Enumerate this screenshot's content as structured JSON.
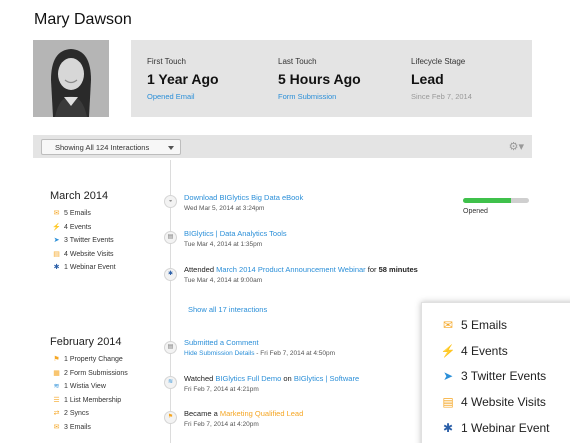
{
  "contact": {
    "name": "Mary Dawson"
  },
  "summary": {
    "first_touch": {
      "label": "First Touch",
      "value": "1 Year Ago",
      "detail": "Opened Email"
    },
    "last_touch": {
      "label": "Last Touch",
      "value": "5 Hours Ago",
      "detail": "Form Submission"
    },
    "lifecycle": {
      "label": "Lifecycle Stage",
      "value": "Lead",
      "detail": "Since Feb 7, 2014"
    }
  },
  "filter": {
    "label": "Showing All 124 Interactions"
  },
  "months": [
    {
      "title": "March 2014",
      "stats": [
        "5 Emails",
        "4 Events",
        "3 Twitter Events",
        "4 Website Visits",
        "1 Webinar Event"
      ]
    },
    {
      "title": "February 2014",
      "stats": [
        "1 Property Change",
        "2 Form Submissions",
        "1 Wistia View",
        "1 List Membership",
        "2 Syncs",
        "3 Emails"
      ]
    }
  ],
  "events": [
    {
      "title_link": "Download BIGlytics Big Data eBook",
      "date": "Wed Mar 5, 2014 at 3:24pm",
      "status": "Opened",
      "open_progress": 0.72
    },
    {
      "title_link": "BIGlytics | Data Analytics Tools",
      "date": "Tue Mar 4, 2014 at 1:35pm"
    },
    {
      "prefix": "Attended",
      "title_link": "March 2014 Product Announcement Webinar",
      "suffix_pre": "for",
      "suffix_bold": "58 minutes",
      "date": "Tue Mar 4, 2014 at 9:00am"
    },
    {
      "title_link": "Submitted a Comment",
      "detail_link": "Hide Submission Details",
      "date": "- Fri Feb 7, 2014 at 4:50pm"
    },
    {
      "prefix": "Watched",
      "title_link": "BIGlytics Full Demo",
      "mid": "on",
      "title_link2": "BIGlytics | Software",
      "date": "Fri Feb 7, 2014 at 4:21pm"
    },
    {
      "prefix": "Became a",
      "title_highlight": "Marketing Qualified Lead",
      "date": "Fri Feb 7, 2014 at 4:20pm"
    }
  ],
  "show_all": "Show all 17 interactions",
  "popover": {
    "items": [
      "5 Emails",
      "4 Events",
      "3 Twitter Events",
      "4 Website Visits",
      "1 Webinar Event"
    ]
  },
  "colors": {
    "link": "#2b8fd8",
    "highlight": "#f5a623",
    "opened": "#3fc14b",
    "panel": "#e4e4e4"
  },
  "icons": {
    "march": [
      "email-icon",
      "lightning-icon",
      "twitter-bird-icon",
      "website-visit-icon",
      "webinar-gear-icon"
    ],
    "february": [
      "flag-icon",
      "form-icon",
      "wistia-play-icon",
      "list-icon",
      "sync-icon",
      "email-icon"
    ]
  }
}
